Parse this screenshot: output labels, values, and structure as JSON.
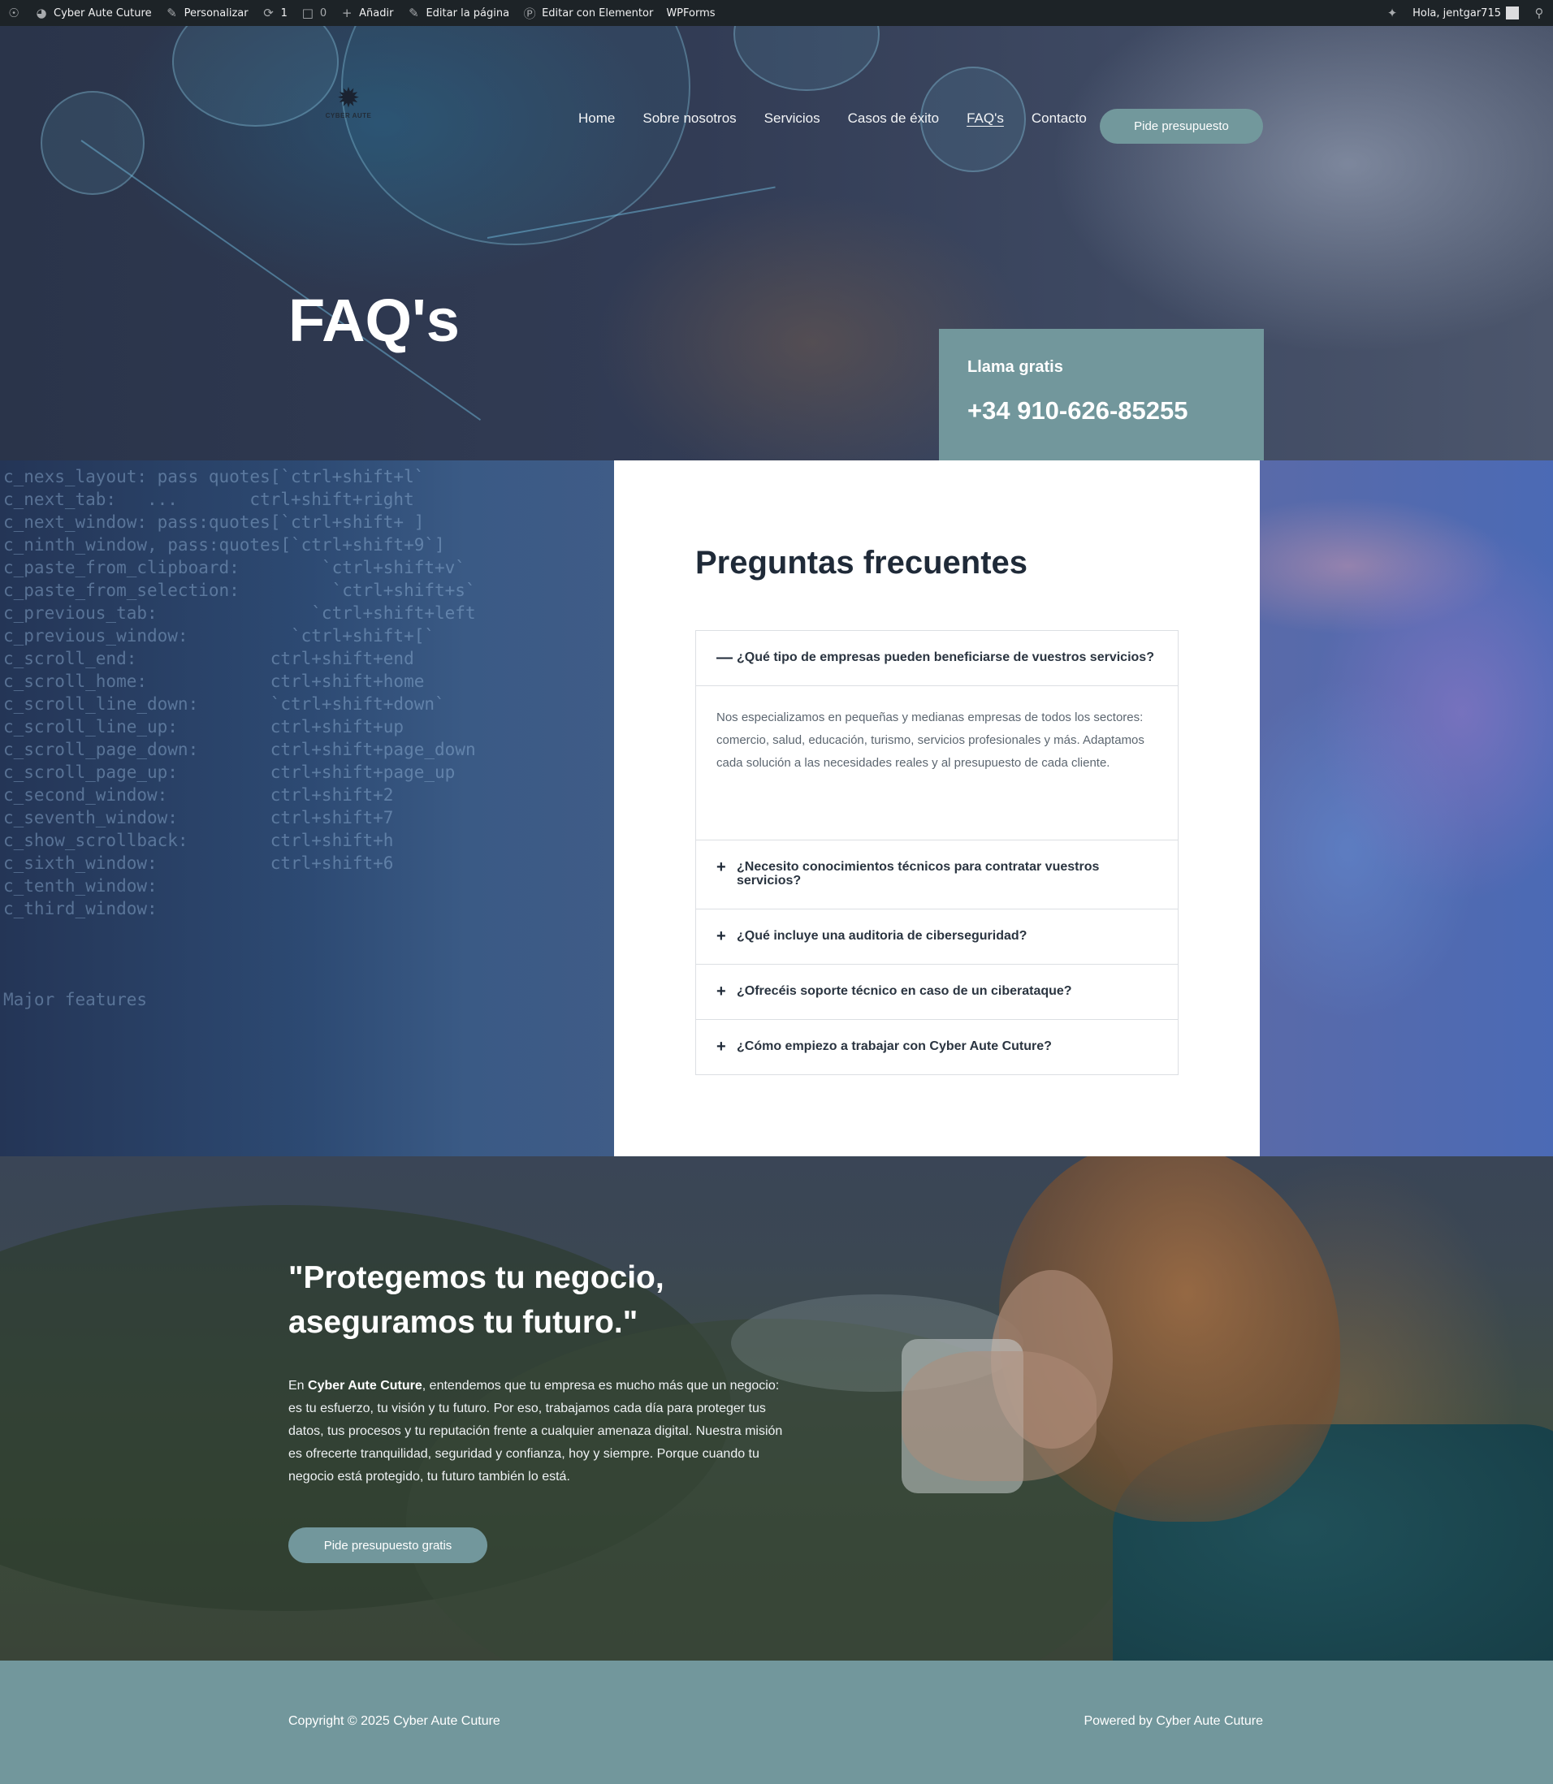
{
  "adminbar": {
    "site_name": "Cyber Aute Cuture",
    "customize": "Personalizar",
    "updates_count": "1",
    "comments_count": "0",
    "add_new": "Añadir",
    "edit_page": "Editar la página",
    "edit_elementor": "Editar con Elementor",
    "wpforms": "WPForms",
    "greeting": "Hola, jentgar715"
  },
  "header": {
    "logo_text": "CYBER AUTE",
    "nav": [
      "Home",
      "Sobre nosotros",
      "Servicios",
      "Casos de éxito",
      "FAQ's",
      "Contacto"
    ],
    "active_nav": "FAQ's",
    "cta_label": "Pide presupuesto"
  },
  "hero": {
    "title": "FAQ's",
    "call_label": "Llama gratis",
    "phone": "+34 910-626-85255"
  },
  "faq": {
    "title": "Preguntas frecuentes",
    "items": [
      {
        "question": "¿Qué tipo de empresas pueden beneficiarse de vuestros servicios?",
        "expanded": true,
        "answer": "Nos especializamos en pequeñas y medianas empresas de todos los sectores: comercio, salud, educación, turismo, servicios profesionales y más. Adaptamos cada solución a las necesidades reales y al presupuesto de cada cliente."
      },
      {
        "question": "¿Necesito conocimientos técnicos para contratar vuestros servicios?",
        "expanded": false
      },
      {
        "question": "¿Qué incluye una auditoria de ciberseguridad?",
        "expanded": false
      },
      {
        "question": "¿Ofrecéis soporte técnico en caso de un ciberataque?",
        "expanded": false
      },
      {
        "question": "¿Cómo empiezo a trabajar con Cyber Aute Cuture?",
        "expanded": false
      }
    ],
    "icon_expanded": "minus-icon",
    "icon_collapsed": "plus-icon"
  },
  "quote": {
    "title": "\"Protegemos tu negocio, aseguramos tu futuro.\"",
    "text_prefix": "En ",
    "text_brand": "Cyber Aute Cuture",
    "text_rest": ", entendemos que tu empresa es mucho más que un negocio: es tu esfuerzo, tu visión y tu futuro. Por eso, trabajamos cada día para proteger tus datos, tus procesos y tu reputación frente a cualquier amenaza digital. Nuestra misión es ofrecerte tranquilidad, seguridad y confianza, hoy y siempre. Porque cuando tu negocio está protegido, tu futuro también lo está.",
    "button": "Pide presupuesto gratis"
  },
  "footer": {
    "copyright": "Copyright © 2025 Cyber Aute Cuture",
    "powered": "Powered by Cyber Aute Cuture"
  },
  "colors": {
    "accent": "#72979c",
    "adminbar": "#1d2327",
    "heading": "#1f2a38"
  }
}
